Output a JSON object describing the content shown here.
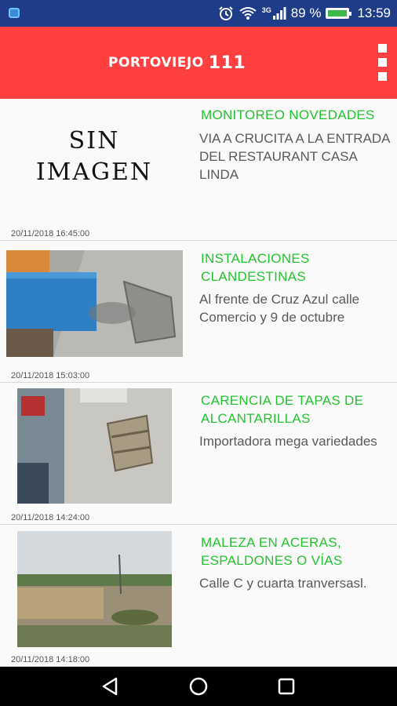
{
  "status_bar": {
    "network": "3G",
    "battery": "89 %",
    "battery_level": 0.89,
    "time": "13:59"
  },
  "app_bar": {
    "title": "PORTOVIEJO",
    "number": "111"
  },
  "items": [
    {
      "category": "MONITOREO NOVEDADES",
      "description": "VIA A CRUCITA A LA ENTRADA DEL RESTAURANT CASA LINDA",
      "date": "20/11/2018 16:45:00",
      "image_placeholder_line1": "SIN",
      "image_placeholder_line2": "IMAGEN"
    },
    {
      "category": "INSTALACIONES CLANDESTINAS",
      "description": "Al frente de Cruz Azul calle Comercio y 9 de octubre",
      "date": "20/11/2018 15:03:00"
    },
    {
      "category": "CARENCIA DE TAPAS DE ALCANTARILLAS",
      "description": "Importadora mega variedades",
      "date": "20/11/2018 14:24:00"
    },
    {
      "category": "MALEZA EN ACERAS, ESPALDONES O VÍAS",
      "description": "Calle C y cuarta tranversasl.",
      "date": "20/11/2018 14:18:00"
    }
  ],
  "colors": {
    "status_bar": "#1f3c88",
    "app_bar": "#ff4040",
    "category_text": "#22c32e"
  }
}
